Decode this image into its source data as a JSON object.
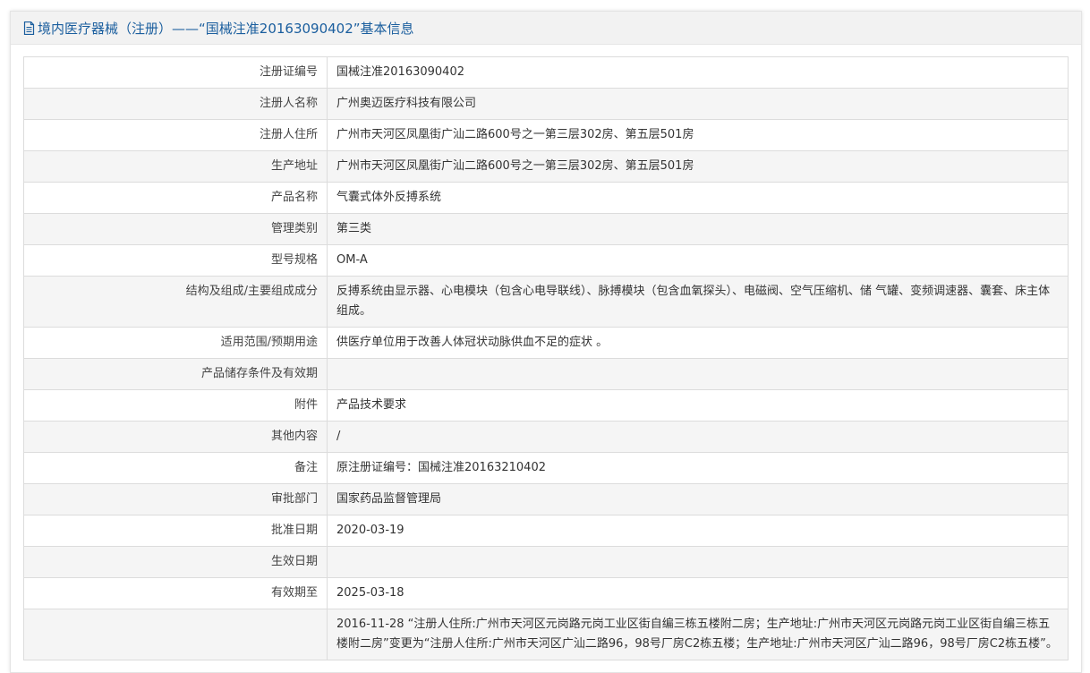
{
  "header": {
    "title": "境内医疗器械（注册）——“国械注准20163090402”基本信息",
    "icon": "document-icon"
  },
  "rows": [
    {
      "label": "注册证编号",
      "value": "国械注准20163090402"
    },
    {
      "label": "注册人名称",
      "value": "广州奥迈医疗科技有限公司"
    },
    {
      "label": "注册人住所",
      "value": "广州市天河区凤凰街广汕二路600号之一第三层302房、第五层501房"
    },
    {
      "label": "生产地址",
      "value": "广州市天河区凤凰街广汕二路600号之一第三层302房、第五层501房"
    },
    {
      "label": "产品名称",
      "value": "气囊式体外反搏系统"
    },
    {
      "label": "管理类别",
      "value": "第三类"
    },
    {
      "label": "型号规格",
      "value": "OM-A"
    },
    {
      "label": "结构及组成/主要组成成分",
      "value": "反搏系统由显示器、心电模块（包含心电导联线）、脉搏模块（包含血氧探头）、电磁阀、空气压缩机、储 气罐、变频调速器、囊套、床主体组成。"
    },
    {
      "label": "适用范围/预期用途",
      "value": "供医疗单位用于改善人体冠状动脉供血不足的症状 。"
    },
    {
      "label": "产品储存条件及有效期",
      "value": ""
    },
    {
      "label": "附件",
      "value": "产品技术要求"
    },
    {
      "label": "其他内容",
      "value": "/"
    },
    {
      "label": "备注",
      "value": "原注册证编号：国械注准20163210402"
    },
    {
      "label": "审批部门",
      "value": "国家药品监督管理局"
    },
    {
      "label": "批准日期",
      "value": "2020-03-19"
    },
    {
      "label": "生效日期",
      "value": ""
    },
    {
      "label": "有效期至",
      "value": "2025-03-18"
    },
    {
      "label": "",
      "value": "2016-11-28 “注册人住所:广州市天河区元岗路元岗工业区街自编三栋五楼附二房；生产地址:广州市天河区元岗路元岗工业区街自编三栋五楼附二房”变更为“注册人住所:广州市天河区广汕二路96，98号厂房C2栋五楼；生产地址:广州市天河区广汕二路96，98号厂房C2栋五楼”。"
    }
  ],
  "colors": {
    "header_text": "#1a5e9e",
    "header_bg": "#f2f2f2",
    "row_alt_bg": "#f5f5f5",
    "border": "#dcdcdc"
  }
}
